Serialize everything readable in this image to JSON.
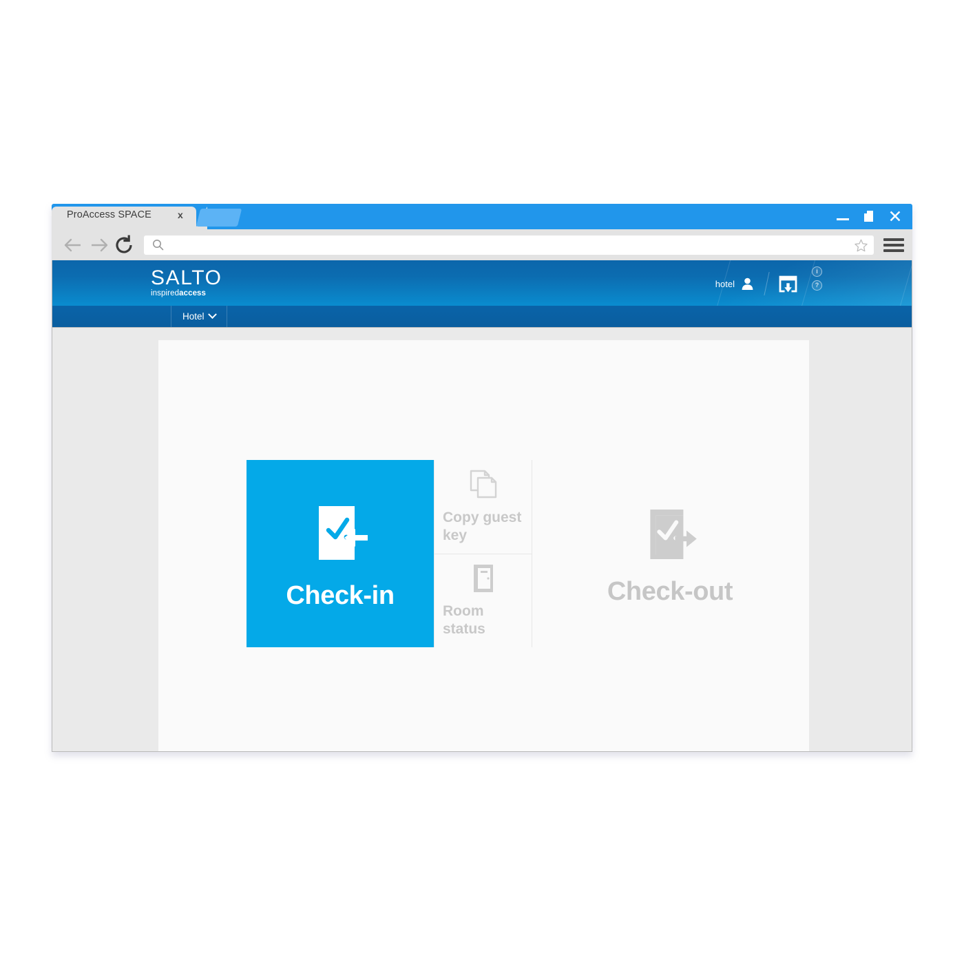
{
  "browser": {
    "tab": {
      "title": "ProAccess SPACE",
      "close_label": "x"
    },
    "new_tab_label": "",
    "window_controls": {
      "minimize": "minimize-icon",
      "maximize": "maximize-icon",
      "close": "✕"
    },
    "toolbar": {
      "back": "back-arrow-icon",
      "forward": "forward-arrow-icon",
      "reload": "reload-icon",
      "search_icon": "search-icon",
      "url_value": "",
      "url_placeholder": "",
      "bookmark": "star-icon",
      "menu": "hamburger-menu-icon"
    }
  },
  "app": {
    "logo": {
      "word": "SALTO",
      "tagline_light": "inspired",
      "tagline_bold": "access"
    },
    "header": {
      "user_label": "hotel",
      "user_icon": "user-icon",
      "download_icon": "download-window-icon",
      "info_badge": "i",
      "help_badge": "?"
    },
    "nav": {
      "items": [
        {
          "label": "Hotel",
          "has_chevron": true
        }
      ]
    },
    "tiles": {
      "primary": {
        "label": "Check-in",
        "icon": "door-check-in-icon"
      },
      "middle": [
        {
          "label": "Copy guest key",
          "icon": "copy-documents-icon"
        },
        {
          "label": "Room status",
          "icon": "door-icon"
        }
      ],
      "secondary": {
        "label": "Check-out",
        "icon": "door-check-out-icon"
      }
    }
  },
  "colors": {
    "brand_cyan": "#04a9e8",
    "header_blue_top": "#0c66ab",
    "header_blue_bottom": "#0a8ccf",
    "nav_blue": "#0a5e9f",
    "disabled_gray": "#c8c8c8",
    "tab_blue": "#2196eb"
  }
}
